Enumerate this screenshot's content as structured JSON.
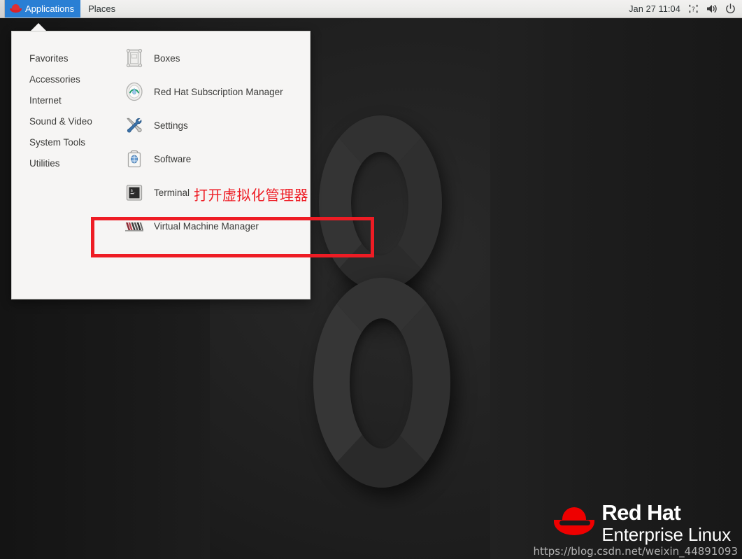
{
  "panel": {
    "applications_label": "Applications",
    "applications_icon": "red-hat-fedora-icon",
    "places_label": "Places",
    "clock": "Jan 27  11:04",
    "accessibility_icon": "accessibility-icon",
    "volume_icon": "volume-icon",
    "power_icon": "power-icon"
  },
  "menu": {
    "categories": [
      {
        "label": "Favorites"
      },
      {
        "label": "Accessories"
      },
      {
        "label": "Internet"
      },
      {
        "label": "Sound & Video"
      },
      {
        "label": "System Tools"
      },
      {
        "label": "Utilities"
      }
    ],
    "apps": [
      {
        "label": "Boxes",
        "icon": "boxes-icon"
      },
      {
        "label": "Red Hat Subscription Manager",
        "icon": "subscription-manager-icon"
      },
      {
        "label": "Settings",
        "icon": "settings-tools-icon"
      },
      {
        "label": "Software",
        "icon": "software-bag-icon"
      },
      {
        "label": "Terminal",
        "icon": "terminal-icon"
      },
      {
        "label": "Virtual Machine Manager",
        "icon": "virtual-machine-manager-icon"
      }
    ]
  },
  "annotation": {
    "note_text": "打开虚拟化管理器",
    "color": "#ee1c24"
  },
  "branding": {
    "line1": "Red Hat",
    "line2": "Enterprise Linux",
    "logo_icon": "red-hat-logo-icon"
  },
  "watermark": {
    "text": "https://blog.csdn.net/weixin_44891093"
  }
}
